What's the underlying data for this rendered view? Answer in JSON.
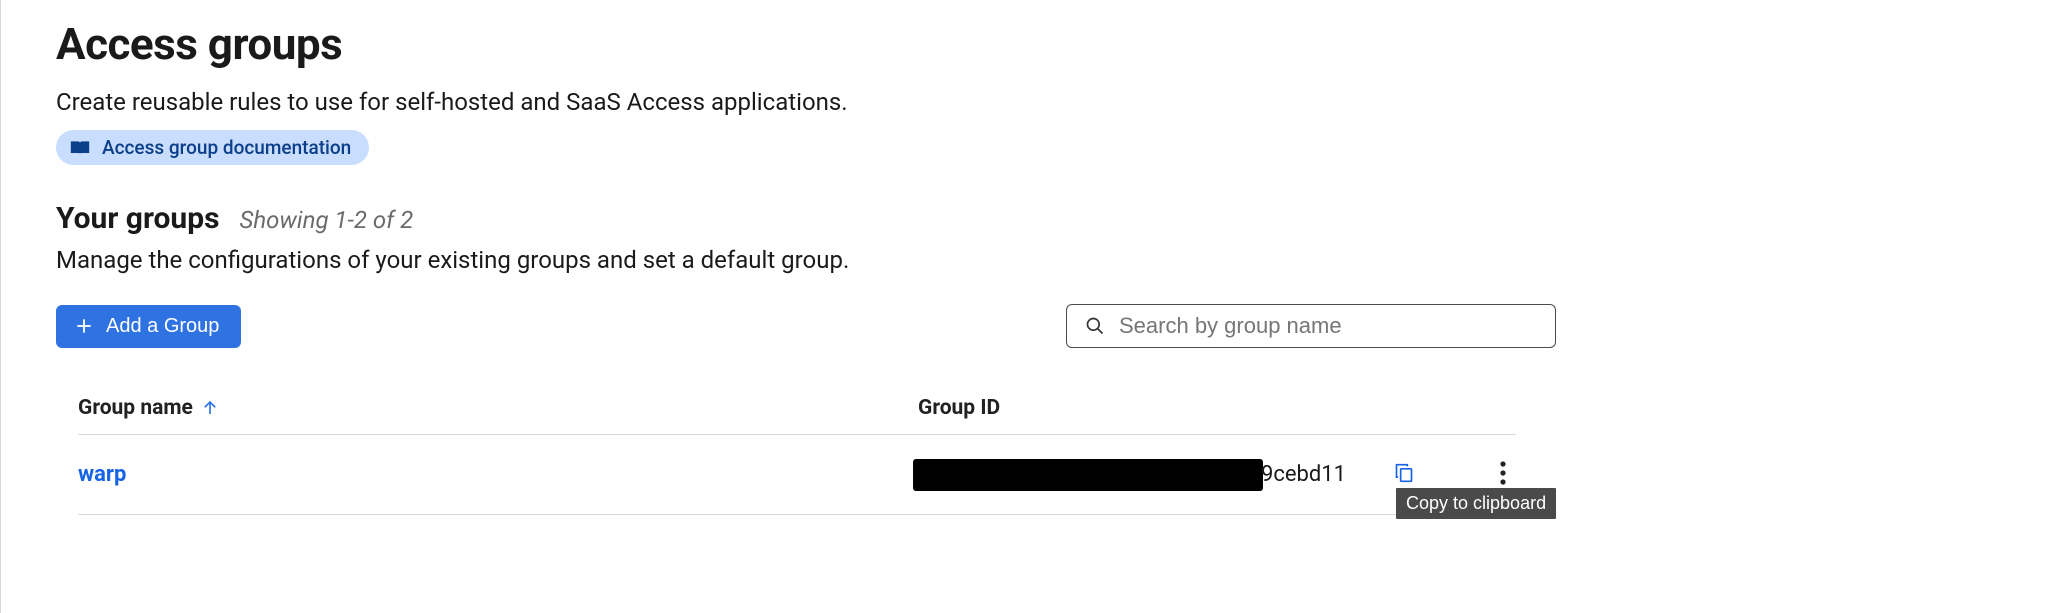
{
  "header": {
    "title": "Access groups",
    "description": "Create reusable rules to use for self-hosted and SaaS Access applications.",
    "doc_link_label": "Access group documentation"
  },
  "section": {
    "title": "Your groups",
    "count_text": "Showing 1-2 of 2",
    "description": "Manage the configurations of your existing groups and set a default group."
  },
  "toolbar": {
    "add_label": "Add a Group",
    "search_placeholder": "Search by group name"
  },
  "table": {
    "columns": {
      "name": "Group name",
      "id": "Group ID"
    },
    "rows": [
      {
        "name": "warp",
        "id_visible_suffix": "9cebd11"
      }
    ]
  },
  "tooltip": {
    "copy": "Copy to clipboard"
  }
}
